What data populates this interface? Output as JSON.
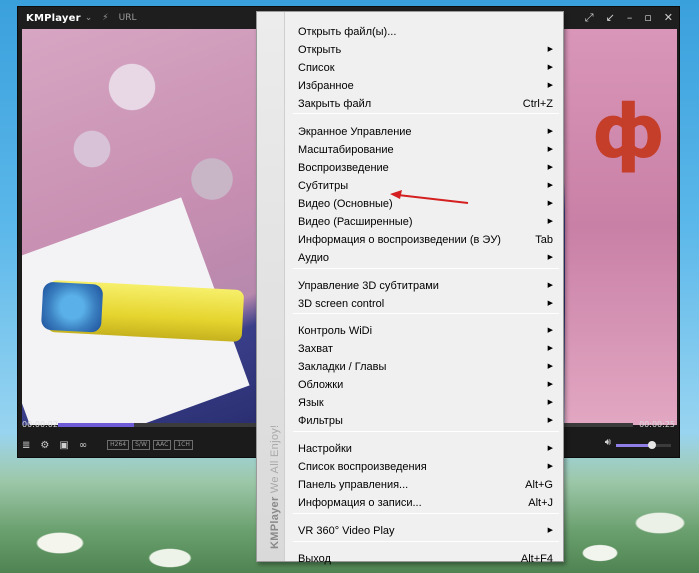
{
  "player": {
    "logo": "KMPlayer",
    "logo_caret": "⌄",
    "lightning": "⚡",
    "url_label": "URL",
    "time_elapsed": "00:00:02",
    "time_total": "00:00:25",
    "progress_fraction": 0.38,
    "volume_fraction": 0.65,
    "badges": [
      "H264",
      "S/W",
      "AAC",
      "1CH"
    ]
  },
  "menu": {
    "brand_stripe": "KMPlayer",
    "brand_tagline": "We All Enjoy!",
    "items": [
      {
        "label": "Открыть файл(ы)...",
        "shortcut": "",
        "submenu": false
      },
      {
        "label": "Открыть",
        "shortcut": "",
        "submenu": true
      },
      {
        "label": "Список",
        "shortcut": "",
        "submenu": true
      },
      {
        "label": "Избранное",
        "shortcut": "",
        "submenu": true
      },
      {
        "label": "Закрыть файл",
        "shortcut": "Ctrl+Z",
        "submenu": false
      },
      {
        "label": "Экранное Управление",
        "shortcut": "",
        "submenu": true
      },
      {
        "label": "Масштабирование",
        "shortcut": "",
        "submenu": true
      },
      {
        "label": "Воспроизведение",
        "shortcut": "",
        "submenu": true
      },
      {
        "label": "Субтитры",
        "shortcut": "",
        "submenu": true
      },
      {
        "label": "Видео (Основные)",
        "shortcut": "",
        "submenu": true
      },
      {
        "label": "Видео (Расширенные)",
        "shortcut": "",
        "submenu": true
      },
      {
        "label": "Информация о воспроизведении (в ЭУ)",
        "shortcut": "Tab",
        "submenu": false
      },
      {
        "label": "Аудио",
        "shortcut": "",
        "submenu": true
      },
      {
        "label": "Управление 3D субтитрами",
        "shortcut": "",
        "submenu": true
      },
      {
        "label": "3D screen control",
        "shortcut": "",
        "submenu": true
      },
      {
        "label": "Контроль WiDi",
        "shortcut": "",
        "submenu": true
      },
      {
        "label": "Захват",
        "shortcut": "",
        "submenu": true
      },
      {
        "label": "Закладки / Главы",
        "shortcut": "",
        "submenu": true
      },
      {
        "label": "Обложки",
        "shortcut": "",
        "submenu": true
      },
      {
        "label": "Язык",
        "shortcut": "",
        "submenu": true
      },
      {
        "label": "Фильтры",
        "shortcut": "",
        "submenu": true
      },
      {
        "label": "Настройки",
        "shortcut": "",
        "submenu": true
      },
      {
        "label": "Список воспроизведения",
        "shortcut": "",
        "submenu": true
      },
      {
        "label": "Панель управления...",
        "shortcut": "Alt+G",
        "submenu": false
      },
      {
        "label": "Информация о записи...",
        "shortcut": "Alt+J",
        "submenu": false
      },
      {
        "label": "VR 360° Video Play",
        "shortcut": "",
        "submenu": true
      },
      {
        "label": "Выход",
        "shortcut": "Alt+F4",
        "submenu": false
      }
    ],
    "highlighted_item": "Видео (Основные)"
  },
  "colors": {
    "arrow_annotation": "#d42020",
    "progress": "#6e5bd6"
  }
}
